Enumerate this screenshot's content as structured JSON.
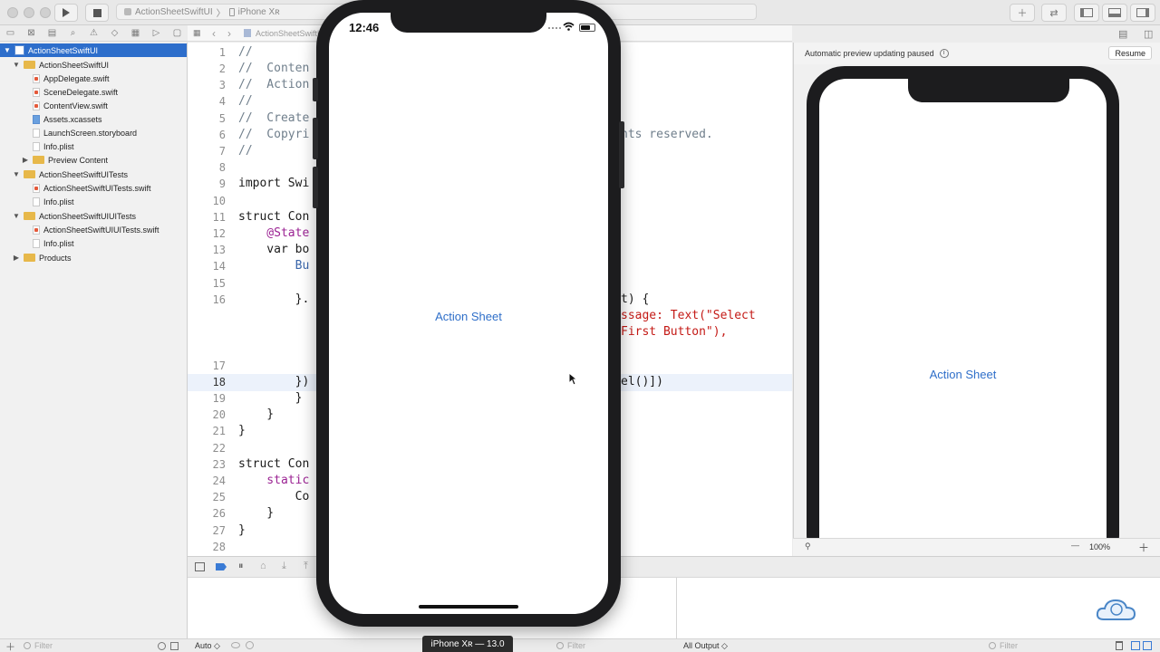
{
  "toolbar": {
    "scheme_project": "ActionSheetSwiftUI",
    "scheme_sep": "〉",
    "scheme_device": "iPhone Xʀ"
  },
  "navigator": {
    "items": [
      {
        "label": "ActionSheetSwiftUI",
        "kind": "project",
        "disclosure": "▼"
      },
      {
        "label": "ActionSheetSwiftUI",
        "kind": "folder",
        "disclosure": "▼"
      },
      {
        "label": "AppDelegate.swift",
        "kind": "swift"
      },
      {
        "label": "SceneDelegate.swift",
        "kind": "swift"
      },
      {
        "label": "ContentView.swift",
        "kind": "swift"
      },
      {
        "label": "Assets.xcassets",
        "kind": "assets"
      },
      {
        "label": "LaunchScreen.storyboard",
        "kind": "file"
      },
      {
        "label": "Info.plist",
        "kind": "file"
      },
      {
        "label": "Preview Content",
        "kind": "folder",
        "disclosure": "▶"
      },
      {
        "label": "ActionSheetSwiftUITests",
        "kind": "folder",
        "disclosure": "▼"
      },
      {
        "label": "ActionSheetSwiftUITests.swift",
        "kind": "swift"
      },
      {
        "label": "Info.plist",
        "kind": "file"
      },
      {
        "label": "ActionSheetSwiftUIUITests",
        "kind": "folder",
        "disclosure": "▼"
      },
      {
        "label": "ActionSheetSwiftUIUITests.swift",
        "kind": "swift"
      },
      {
        "label": "Info.plist",
        "kind": "file"
      },
      {
        "label": "Products",
        "kind": "folder",
        "disclosure": "▶"
      }
    ],
    "filter_placeholder": "Filter"
  },
  "editor": {
    "jump_file": "ActionSheetSwiftUI",
    "lines": [
      {
        "n": "1",
        "text": "//"
      },
      {
        "n": "2",
        "text": "//  Conten"
      },
      {
        "n": "3",
        "text": "//  Action"
      },
      {
        "n": "4",
        "text": "//"
      },
      {
        "n": "5",
        "text": "//  Create"
      },
      {
        "n": "6",
        "text": "//  Copyri",
        "right": "nts reserved."
      },
      {
        "n": "7",
        "text": "//"
      },
      {
        "n": "8",
        "text": ""
      },
      {
        "n": "9",
        "text": "import Swi"
      },
      {
        "n": "10",
        "text": ""
      },
      {
        "n": "11",
        "text": "struct Con"
      },
      {
        "n": "12",
        "text": "    @State"
      },
      {
        "n": "13",
        "text": "    var bo"
      },
      {
        "n": "14",
        "text": "        Bu"
      },
      {
        "n": "15",
        "text": ""
      },
      {
        "n": "16",
        "text": "        }.",
        "right": "t) {"
      },
      {
        "n": "",
        "text": "",
        "right": "ssage: Text(\"Select"
      },
      {
        "n": "",
        "text": "",
        "right": "First Button\"),"
      },
      {
        "n": "17",
        "text": ""
      },
      {
        "n": "18",
        "text": "        })",
        "right": "el()])"
      },
      {
        "n": "19",
        "text": "        }"
      },
      {
        "n": "20",
        "text": "    }"
      },
      {
        "n": "21",
        "text": "}"
      },
      {
        "n": "22",
        "text": ""
      },
      {
        "n": "23",
        "text": "struct Con"
      },
      {
        "n": "24",
        "text": "    static"
      },
      {
        "n": "25",
        "text": "        Co"
      },
      {
        "n": "26",
        "text": "    }"
      },
      {
        "n": "27",
        "text": "}"
      },
      {
        "n": "28",
        "text": ""
      }
    ]
  },
  "canvas": {
    "status": "Automatic preview updating paused",
    "resume_label": "Resume",
    "preview_button": "Action Sheet",
    "zoom": "100%"
  },
  "debug": {
    "auto_label": "Auto ◇",
    "filter_placeholder": "Filter",
    "output_label": "All Output ◇",
    "output_filter": "Filter"
  },
  "simulator": {
    "time": "12:46",
    "button": "Action Sheet",
    "device_label": "iPhone Xʀ — 13.0"
  },
  "colors": {
    "accent": "#2f6fc9",
    "selection": "#2d6ecb",
    "device_frame": "#1c1c1e"
  }
}
